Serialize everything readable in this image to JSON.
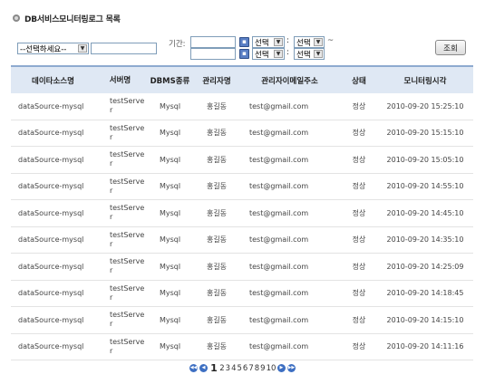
{
  "title": "DB서비스모니터링로그 목록",
  "filter": {
    "select_placeholder": "--선택하세요--",
    "search_value": "",
    "period_label": "기간:",
    "tilde": "~",
    "hour_select": "선택",
    "minute_select": "선택",
    "colon": ":",
    "search_button": "조회"
  },
  "table": {
    "headers": [
      "데이타소스명",
      "서버명",
      "DBMS종류",
      "관리자명",
      "관리자이메일주소",
      "상태",
      "모니터링시각"
    ],
    "rows": [
      [
        "dataSource-mysql",
        "testServer",
        "Mysql",
        "홍길동",
        "test@gmail.com",
        "정상",
        "2010-09-20 15:25:10"
      ],
      [
        "dataSource-mysql",
        "testServer",
        "Mysql",
        "홍길동",
        "test@gmail.com",
        "정상",
        "2010-09-20 15:15:10"
      ],
      [
        "dataSource-mysql",
        "testServer",
        "Mysql",
        "홍길동",
        "test@gmail.com",
        "정상",
        "2010-09-20 15:05:10"
      ],
      [
        "dataSource-mysql",
        "testServer",
        "Mysql",
        "홍길동",
        "test@gmail.com",
        "정상",
        "2010-09-20 14:55:10"
      ],
      [
        "dataSource-mysql",
        "testServer",
        "Mysql",
        "홍길동",
        "test@gmail.com",
        "정상",
        "2010-09-20 14:45:10"
      ],
      [
        "dataSource-mysql",
        "testServer",
        "Mysql",
        "홍길동",
        "test@gmail.com",
        "정상",
        "2010-09-20 14:35:10"
      ],
      [
        "dataSource-mysql",
        "testServer",
        "Mysql",
        "홍길동",
        "test@gmail.com",
        "정상",
        "2010-09-20 14:25:09"
      ],
      [
        "dataSource-mysql",
        "testServer",
        "Mysql",
        "홍길동",
        "test@gmail.com",
        "정상",
        "2010-09-20 14:18:45"
      ],
      [
        "dataSource-mysql",
        "testServer",
        "Mysql",
        "홍길동",
        "test@gmail.com",
        "정상",
        "2010-09-20 14:15:10"
      ],
      [
        "dataSource-mysql",
        "testServer",
        "Mysql",
        "홍길동",
        "test@gmail.com",
        "정상",
        "2010-09-20 14:11:16"
      ]
    ]
  },
  "pagination": {
    "current": "1",
    "pages": [
      "2",
      "3",
      "4",
      "5",
      "6",
      "7",
      "8",
      "9",
      "10"
    ],
    "icons": [
      "first-page-icon",
      "prev-page-icon",
      "next-page-icon",
      "last-page-icon"
    ]
  },
  "colors": {
    "header_bg": "#dfe8f4",
    "header_border": "#8eaad0",
    "pager_blue": "#3d6fc2"
  }
}
